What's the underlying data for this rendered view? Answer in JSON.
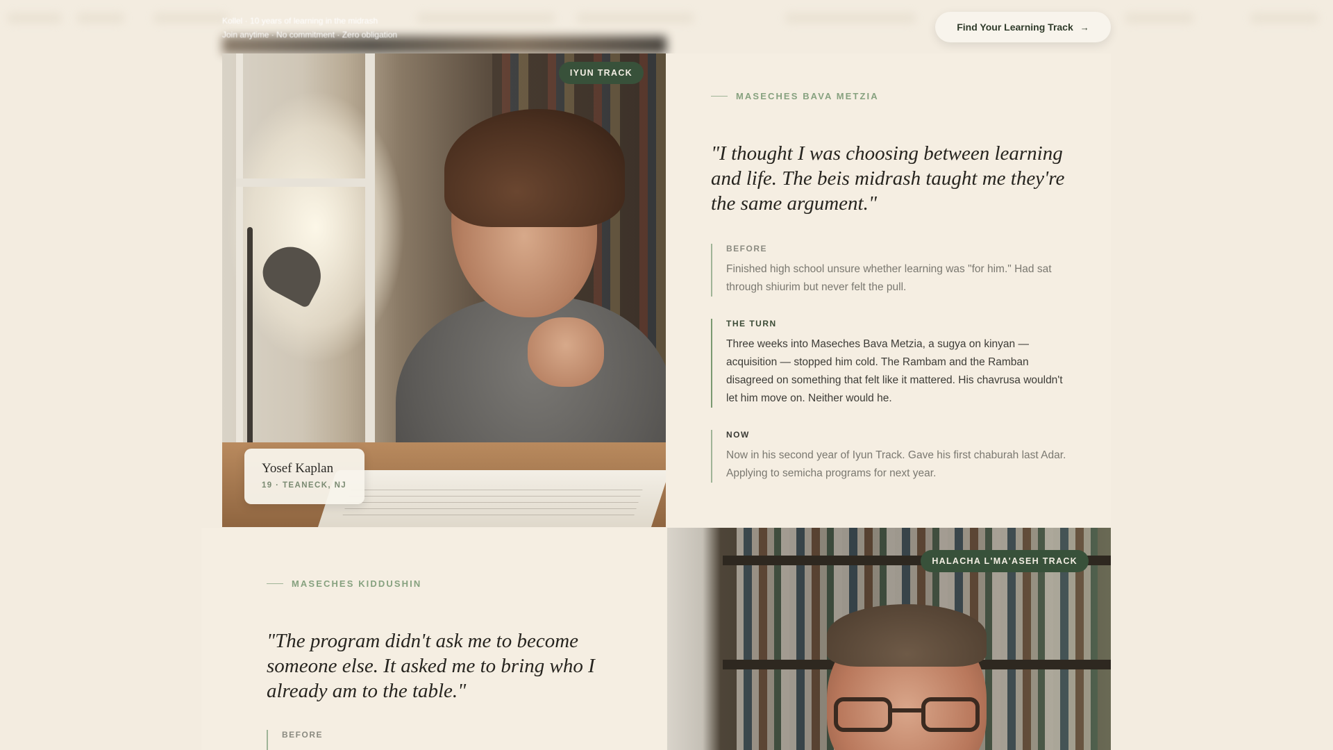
{
  "header": {
    "caption_line1": "Kollel · 10 years of learning in the midrash",
    "caption_line2": "Join anytime · No commitment · Zero obligation",
    "cta_label": "Find Your Learning Track",
    "cta_icon": "arrow-right-icon"
  },
  "stories": [
    {
      "track_badge": "IYUN TRACK",
      "masechta": "MASECHES BAVA METZIA",
      "quote": "\"I thought I was choosing between learning and life. The beis midrash taught me they're the same argument.\"",
      "person": {
        "name": "Yosef Kaplan",
        "meta": "19 · TEANECK, NJ"
      },
      "stages": [
        {
          "label": "BEFORE",
          "text": "Finished high school unsure whether learning was \"for him.\" Had sat through shiurim but never felt the pull."
        },
        {
          "label": "THE TURN",
          "text": "Three weeks into Maseches Bava Metzia, a sugya on kinyan — acquisition — stopped him cold. The Rambam and the Ramban disagreed on something that felt like it mattered. His chavrusa wouldn't let him move on. Neither would he."
        },
        {
          "label": "NOW",
          "text": "Now in his second year of Iyun Track. Gave his first chaburah last Adar. Applying to semicha programs for next year."
        }
      ]
    },
    {
      "track_badge": "HALACHA L'MA'ASEH TRACK",
      "masechta": "MASECHES KIDDUSHIN",
      "quote": "\"The program didn't ask me to become someone else. It asked me to bring who I already am to the table.\"",
      "stages": [
        {
          "label": "BEFORE"
        }
      ]
    }
  ],
  "colors": {
    "page_bg": "#f3ece0",
    "accent_green": "#38513a",
    "eyebrow_green": "#86a17f",
    "text_dark": "#26241f"
  }
}
